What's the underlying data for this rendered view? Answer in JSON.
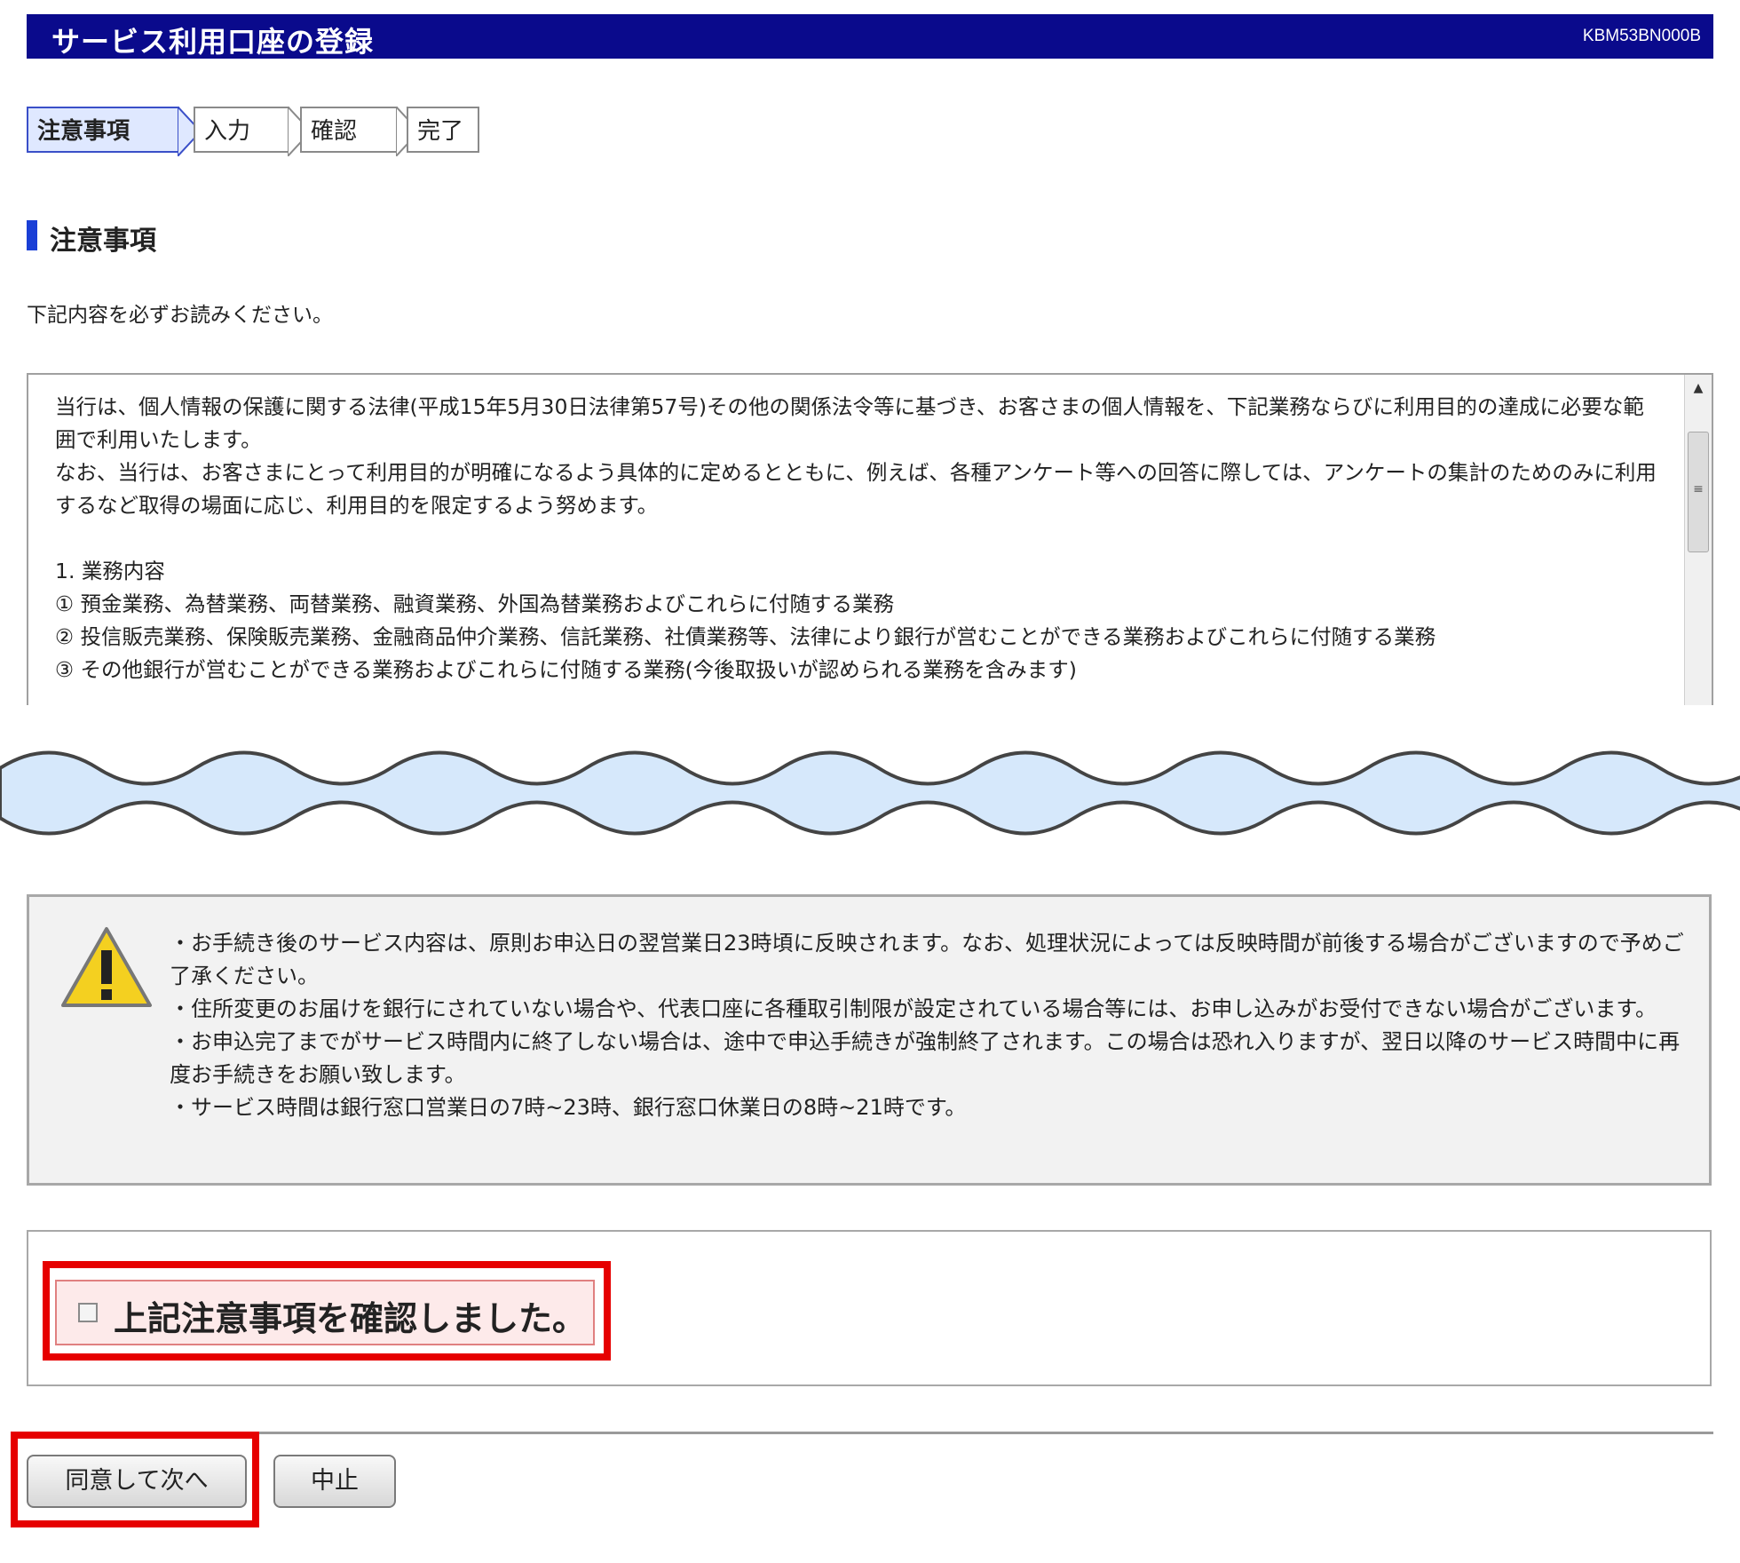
{
  "header": {
    "title": "サービス利用口座の登録",
    "screen_code": "KBM53BN000B"
  },
  "steps": [
    {
      "label": "注意事項",
      "active": true
    },
    {
      "label": "入力",
      "active": false
    },
    {
      "label": "確認",
      "active": false
    },
    {
      "label": "完了",
      "active": false
    }
  ],
  "section": {
    "heading": "注意事項",
    "instruction": "下記内容を必ずお読みください。"
  },
  "terms": {
    "paragraphs": [
      "当行は、個人情報の保護に関する法律(平成15年5月30日法律第57号)その他の関係法令等に基づき、お客さまの個人情報を、下記業務ならびに利用目的の達成に必要な範囲で利用いたします。",
      "なお、当行は、お客さまにとって利用目的が明確になるよう具体的に定めるとともに、例えば、各種アンケート等への回答に際しては、アンケートの集計のためのみに利用するなど取得の場面に応じ、利用目的を限定するよう努めます。",
      "",
      "1. 業務内容",
      "① 預金業務、為替業務、両替業務、融資業務、外国為替業務およびこれらに付随する業務",
      "② 投信販売業務、保険販売業務、金融商品仲介業務、信託業務、社債業務等、法律により銀行が営むことができる業務およびこれらに付随する業務",
      "③ その他銀行が営むことができる業務およびこれらに付随する業務(今後取扱いが認められる業務を含みます)"
    ],
    "scrollbar_icon": "scroll-grip-icon"
  },
  "notice": {
    "icon": "warning-icon",
    "lines": [
      "・お手続き後のサービス内容は、原則お申込日の翌営業日23時頃に反映されます。なお、処理状況によっては反映時間が前後する場合がございますので予めご了承ください。",
      "・住所変更のお届けを銀行にされていない場合や、代表口座に各種取引制限が設定されている場合等には、お申し込みがお受付できない場合がございます。",
      "・お申込完了までがサービス時間内に終了しない場合は、途中で申込手続きが強制終了されます。この場合は恐れ入りますが、翌日以降のサービス時間中に再度お手続きをお願い致します。",
      "・サービス時間は銀行窓口営業日の7時~23時、銀行窓口休業日の8時~21時です。"
    ]
  },
  "confirm": {
    "checkbox_label": "上記注意事項を確認しました。",
    "checked": false
  },
  "buttons": {
    "agree": "同意して次へ",
    "cancel": "中止"
  },
  "colors": {
    "title_bg": "#0a0a8c",
    "highlight": "#e60000",
    "accent": "#1a3fd6"
  }
}
